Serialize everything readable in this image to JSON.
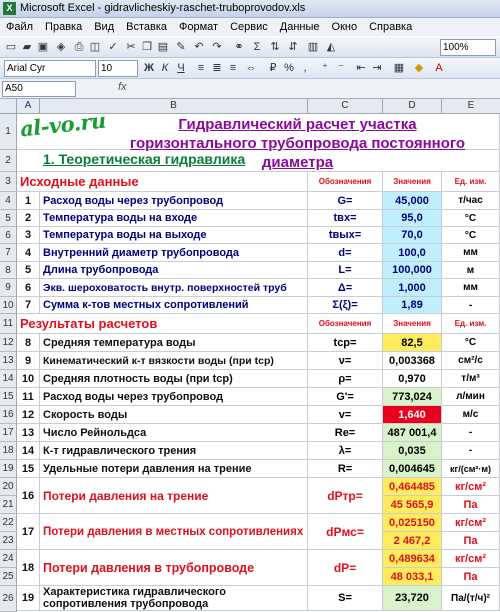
{
  "window": {
    "title": "Microsoft Excel - gidravlicheskiy-raschet-truboprovodov.xls",
    "app_icon": "excel-icon"
  },
  "menu": [
    "Файл",
    "Правка",
    "Вид",
    "Вставка",
    "Формат",
    "Сервис",
    "Данные",
    "Окно",
    "Справка"
  ],
  "toolbar": {
    "font_name": "Arial Cyr",
    "font_size": "10",
    "zoom": "100%",
    "sigma": "Σ"
  },
  "formula_bar": {
    "cell_ref": "A50",
    "fx": "fx",
    "value": ""
  },
  "columns": [
    "A",
    "B",
    "C",
    "D",
    "E"
  ],
  "rows": [
    "1",
    "2",
    "3",
    "4",
    "5",
    "6",
    "7",
    "8",
    "9",
    "10",
    "11",
    "12",
    "13",
    "14",
    "15",
    "16",
    "17",
    "18",
    "19",
    "20",
    "21",
    "22",
    "23",
    "24",
    "25",
    "26"
  ],
  "logo": "al-vo.ru",
  "title_line1": "Гидравлический расчет участка",
  "title_line2": "горизонтального трубопровода постоянного диаметра",
  "section_theory": "1. Теоретическая гидравлика",
  "inputs_header": {
    "label": "Исходные данные",
    "designation": "Обозначения",
    "values": "Значения",
    "unit": "Ед. изм."
  },
  "inputs": [
    {
      "n": "1",
      "label": "Расход воды через трубопровод",
      "sym": "G=",
      "value": "45,000",
      "unit": "т/час"
    },
    {
      "n": "2",
      "label": "Температура воды на входе",
      "sym": "tвх=",
      "value": "95,0",
      "unit": "°С"
    },
    {
      "n": "3",
      "label": "Температура воды на выходе",
      "sym": "tвых=",
      "value": "70,0",
      "unit": "°С"
    },
    {
      "n": "4",
      "label": "Внутренний диаметр трубопровода",
      "sym": "d=",
      "value": "100,0",
      "unit": "мм"
    },
    {
      "n": "5",
      "label": "Длина трубопровода",
      "sym": "L=",
      "value": "100,000",
      "unit": "м"
    },
    {
      "n": "6",
      "label": "Экв. шероховатость внутр. поверхностей труб",
      "sym": "Δ=",
      "value": "1,000",
      "unit": "мм"
    },
    {
      "n": "7",
      "label": "Сумма к-тов местных сопротивлений",
      "sym": "Σ(ξ)=",
      "value": "1,89",
      "unit": "-"
    }
  ],
  "results_header": {
    "label": "Результаты расчетов",
    "designation": "Обозначения",
    "values": "Значения",
    "unit": "Ед. изм."
  },
  "results": [
    {
      "n": "8",
      "label": "Средняя температура воды",
      "sym": "tср=",
      "value": "82,5",
      "unit": "°С"
    },
    {
      "n": "9",
      "label": "Кинематический к-т вязкости воды (при tср)",
      "sym": "ν=",
      "value": "0,003368",
      "unit": "см²/с"
    },
    {
      "n": "10",
      "label": "Средняя плотность воды (при tср)",
      "sym": "ρ=",
      "value": "0,970",
      "unit": "т/м³"
    },
    {
      "n": "11",
      "label": "Расход воды через трубопровод",
      "sym": "G'=",
      "value": "773,024",
      "unit": "л/мин"
    },
    {
      "n": "12",
      "label": "Скорость воды",
      "sym": "v=",
      "value": "1,640",
      "unit": "м/с"
    },
    {
      "n": "13",
      "label": "Число Рейнольдса",
      "sym": "Re=",
      "value": "487 001,4",
      "unit": "-"
    },
    {
      "n": "14",
      "label": "К-т гидравлического трения",
      "sym": "λ=",
      "value": "0,035",
      "unit": "-"
    },
    {
      "n": "15",
      "label": "Удельные потери давления на трение",
      "sym": "R=",
      "value": "0,004645",
      "unit": "кг/(см²·м)"
    }
  ],
  "losses": [
    {
      "n": "16",
      "label": "Потери давления на трение",
      "sym": "dPтр=",
      "value1": "0,464485",
      "unit1": "кг/см²",
      "value2": "45 565,9",
      "unit2": "Па"
    },
    {
      "n": "17",
      "label": "Потери давления в местных сопротивлениях",
      "sym": "dPмс=",
      "value1": "0,025150",
      "unit1": "кг/см²",
      "value2": "2 467,2",
      "unit2": "Па"
    },
    {
      "n": "18",
      "label": "Потери давления в трубопроводе",
      "sym": "dP=",
      "value1": "0,489634",
      "unit1": "кг/см²",
      "value2": "48 033,1",
      "unit2": "Па"
    }
  ],
  "characteristic": {
    "n": "19",
    "label_line1": "Характеристика гидравлического",
    "label_line2": "сопротивления трубопровода",
    "sym": "S=",
    "value": "23,720",
    "unit": "Па/(т/ч)²"
  }
}
